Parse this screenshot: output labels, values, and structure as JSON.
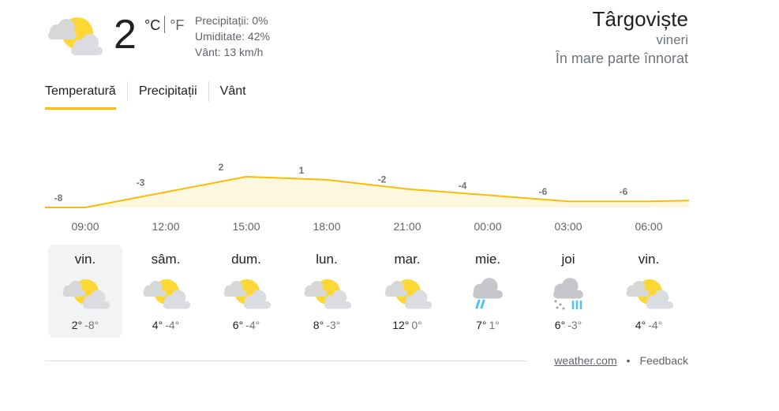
{
  "current": {
    "temp": "2",
    "unit_c": "°C",
    "unit_f": "°F",
    "icon": "partly-cloudy-icon",
    "precipitation": "Precipitații: 0%",
    "humidity": "Umiditate: 42%",
    "wind": "Vânt: 13 km/h"
  },
  "location": {
    "city": "Târgoviște",
    "day": "vineri",
    "condition": "În mare parte înnorat"
  },
  "tabs": [
    {
      "label": "Temperatură",
      "active": true
    },
    {
      "label": "Precipitații",
      "active": false
    },
    {
      "label": "Vânt",
      "active": false
    }
  ],
  "colors": {
    "accent": "#fbbc04",
    "area_fill": "#fef7e0",
    "line": "#fbbc04"
  },
  "chart_data": {
    "type": "area",
    "times": [
      "09:00",
      "12:00",
      "15:00",
      "18:00",
      "21:00",
      "00:00",
      "03:00",
      "06:00"
    ],
    "values": [
      -8,
      -3,
      2,
      1,
      -2,
      -4,
      -6,
      -6
    ],
    "title": "",
    "xlabel": "",
    "ylabel": ""
  },
  "days": [
    {
      "name": "vin.",
      "hi": "2°",
      "lo": "-8°",
      "icon": "partly-cloudy-icon",
      "selected": true
    },
    {
      "name": "sâm.",
      "hi": "4°",
      "lo": "-4°",
      "icon": "partly-cloudy-icon",
      "selected": false
    },
    {
      "name": "dum.",
      "hi": "6°",
      "lo": "-4°",
      "icon": "partly-cloudy-icon",
      "selected": false
    },
    {
      "name": "lun.",
      "hi": "8°",
      "lo": "-3°",
      "icon": "partly-cloudy-icon",
      "selected": false
    },
    {
      "name": "mar.",
      "hi": "12°",
      "lo": "0°",
      "icon": "partly-cloudy-icon",
      "selected": false
    },
    {
      "name": "mie.",
      "hi": "7°",
      "lo": "1°",
      "icon": "rain-icon",
      "selected": false
    },
    {
      "name": "joi",
      "hi": "6°",
      "lo": "-3°",
      "icon": "snow-rain-icon",
      "selected": false
    },
    {
      "name": "vin.",
      "hi": "4°",
      "lo": "-4°",
      "icon": "partly-cloudy-icon",
      "selected": false
    }
  ],
  "footer": {
    "source": "weather.com",
    "separator": "•",
    "feedback": "Feedback"
  }
}
